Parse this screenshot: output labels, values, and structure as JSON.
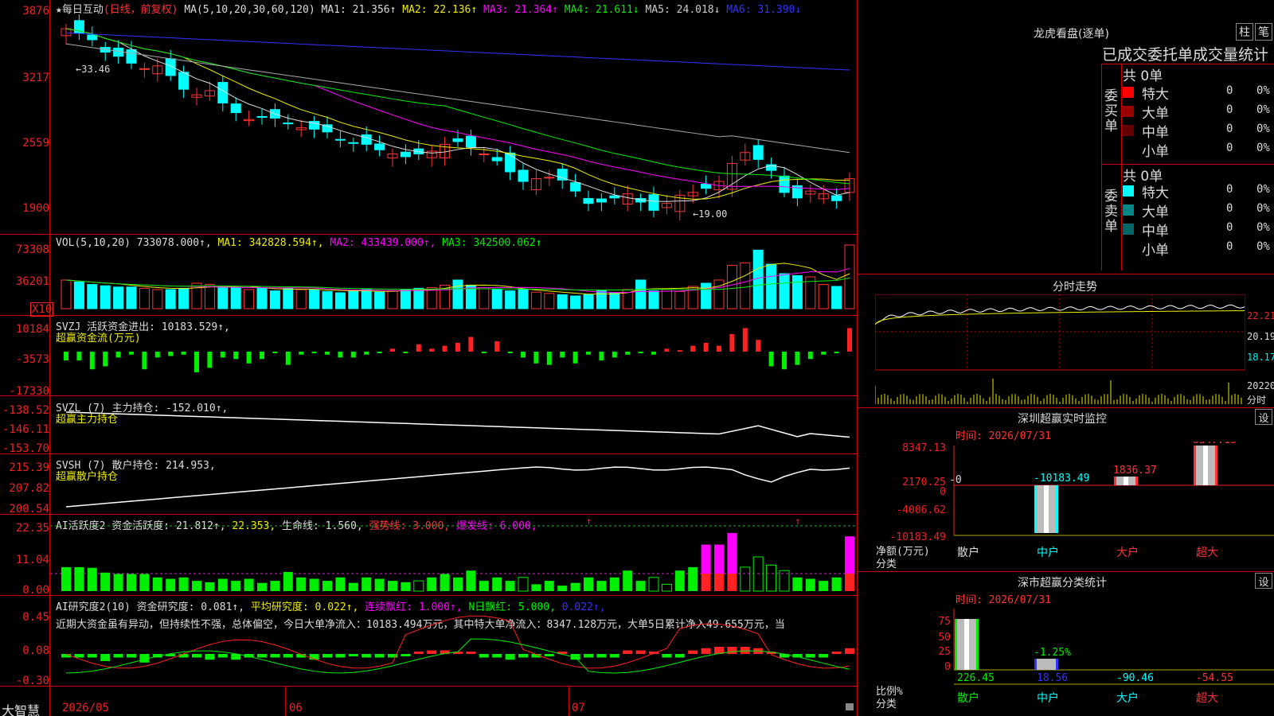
{
  "window": {
    "brand": "大智慧"
  },
  "main": {
    "star": "★",
    "stock_name": "每日互动",
    "period": "(日线，前复权)",
    "ma_label": "MA(5,10,20,30,60,120)",
    "ma": [
      {
        "label": "MA1: 21.356↑",
        "color": "#dddddd"
      },
      {
        "label": "MA2: 22.136↑",
        "color": "#eeee00"
      },
      {
        "label": "MA3: 21.364↑",
        "color": "#ff00ff"
      },
      {
        "label": "MA4: 21.611↓",
        "color": "#00ee00"
      },
      {
        "label": "MA5: 24.018↓",
        "color": "#aaaaaa"
      },
      {
        "label": "MA6: 31.390↓",
        "color": "#3333ff"
      }
    ],
    "yticks": [
      "3876",
      "3217",
      "2559",
      "1900"
    ],
    "high_label": "33.46",
    "low_label": "19.00"
  },
  "vol": {
    "title": "VOL(5,10,20)",
    "value": "733078.000↑,",
    "ma1": "MA1: 342828.594↑,",
    "ma2": "MA2: 433439.000↑,",
    "ma3": "MA3: 342500.062↑",
    "yticks": [
      "73308",
      "36201"
    ],
    "unit": "X10"
  },
  "svzj": {
    "title": "SVZJ  活跃资金进出: 10183.529↑,",
    "sub": "超赢资金流(万元)",
    "yticks": [
      "10184",
      "-3573",
      "-17330"
    ]
  },
  "svzl": {
    "title": "SVZL (7) 主力持仓: -152.010↑,",
    "sub": "超赢主力持仓",
    "yticks": [
      "-138.52",
      "-146.11",
      "-153.70"
    ]
  },
  "svsh": {
    "title": "SVSH (7) 散户持仓: 214.953,",
    "sub": "超赢散户持仓",
    "yticks": [
      "215.39",
      "207.82",
      "200.54"
    ]
  },
  "ai1": {
    "title": "AI活跃度2 资金活跃度: 21.812↑,",
    "v2": "22.353,",
    "v3": "生命线: 1.560,",
    "v4": "强势线: 3.000,",
    "v5": "爆发线: 6.000,",
    "yticks": [
      "22.35",
      "11.04",
      "0.00"
    ]
  },
  "ai2": {
    "title": "AI研究度2(10) 资金研究度: 0.081↑,",
    "v2": "平均研究度: 0.022↑,",
    "v3": "连续飘红: 1.000↑,",
    "v4": "N日飘红: 5.000,",
    "v5": "0.022↑,",
    "text": "近期大资金虽有异动，但持续性不强，总体偏空，今日大单净流入：10183.494万元，其中特大单净流入：8347.128万元，大单5日累计净入49.655万元，当",
    "yticks": [
      "0.45",
      "0.08",
      "-0.30"
    ]
  },
  "xaxis": [
    "2026/05",
    "06",
    "07"
  ],
  "right": {
    "lhkp_title": "龙虎看盘(逐单)",
    "btn1": "柱",
    "btn2": "笔",
    "tabs": "已成交委托单成交量统计",
    "buy_label": "委买单",
    "sell_label": "委卖单",
    "buy_total": "共 0单",
    "sell_total": "共 0单",
    "buy_rows": [
      {
        "name": "特大",
        "count": "0",
        "pct": "0%",
        "color": "#ff0000"
      },
      {
        "name": "大单",
        "count": "0",
        "pct": "0%",
        "color": "#990000"
      },
      {
        "name": "中单",
        "count": "0",
        "pct": "0%",
        "color": "#660000"
      },
      {
        "name": "小单",
        "count": "0",
        "pct": "0%",
        "color": "#000000"
      }
    ],
    "sell_rows": [
      {
        "name": "特大",
        "count": "0",
        "pct": "0%",
        "color": "#00ffff"
      },
      {
        "name": "大单",
        "count": "0",
        "pct": "0%",
        "color": "#008888"
      },
      {
        "name": "中单",
        "count": "0",
        "pct": "0%",
        "color": "#006666"
      },
      {
        "name": "小单",
        "count": "0",
        "pct": "0%",
        "color": "#000000"
      }
    ],
    "fs_title": "分时走势",
    "fs_yticks": [
      "22.21",
      "20.19",
      "18.17"
    ],
    "fs_bottom": [
      "20220",
      "分时"
    ],
    "sz_title": "深圳超赢实时监控",
    "sz_btn": "设",
    "sz_time": "时间: 2026/07/31",
    "sz_yticks": [
      "8347.13",
      "2170.25",
      "0",
      "-4006.62",
      "-10183.49"
    ],
    "sz_zero": "-0",
    "sz_unit1": "净额(万元)",
    "sz_unit2": "分类",
    "sz_cats": [
      "散户",
      "中户",
      "大户",
      "超大"
    ],
    "sz_vals": [
      "-10183.49",
      "1836.37",
      "8347.13"
    ],
    "ss_title": "深市超赢分类统计",
    "ss_btn": "设",
    "ss_time": "时间: 2026/07/31",
    "ss_yticks": [
      "75",
      "50",
      "25",
      "0"
    ],
    "ss_unit1": "比例%",
    "ss_unit2": "分类",
    "ss_pct": "-1.25%",
    "ss_vals": [
      "226.45",
      "18.56",
      "-90.46",
      "-54.55"
    ],
    "ss_cats": [
      "散户",
      "中户",
      "大户",
      "超大"
    ]
  },
  "chart_data": [
    {
      "type": "candlestick",
      "title": "每日互动(日线，前复权)",
      "ylim": [
        19.0,
        33.46
      ],
      "categories": [
        "2026/05",
        "06",
        "07"
      ],
      "close": [
        32.7,
        32.4,
        31.9,
        31.0,
        30.7,
        30.2,
        29.8,
        30.0,
        29.3,
        28.3,
        27.9,
        28.2,
        27.3,
        26.6,
        26.1,
        26.3,
        26.2,
        25.8,
        25.5,
        25.4,
        25.2,
        24.6,
        24.4,
        24.3,
        23.9,
        23.6,
        23.4,
        23.6,
        23.8,
        24.3,
        24.5,
        24.1,
        23.6,
        23.1,
        22.3,
        21.6,
        21.8,
        21.9,
        21.7,
        20.9,
        20.0,
        20.1,
        20.4,
        20.7,
        20.1,
        19.5,
        20.0,
        20.6,
        20.8,
        21.1,
        21.6,
        22.9,
        23.7,
        23.2,
        22.4,
        20.8,
        20.4,
        20.9,
        20.7,
        20.2,
        21.8
      ]
    },
    {
      "type": "bar",
      "title": "VOL(5,10,20)",
      "ylim": [
        0,
        73308
      ]
    },
    {
      "type": "bar",
      "title": "SVZJ 活跃资金进出",
      "ylim": [
        -17330,
        10184
      ]
    },
    {
      "type": "line",
      "title": "SVZL (7) 主力持仓",
      "ylim": [
        -153.7,
        -138.52
      ]
    },
    {
      "type": "line",
      "title": "SVSH (7) 散户持仓",
      "ylim": [
        200.54,
        215.39
      ]
    },
    {
      "type": "bar",
      "title": "AI活跃度2",
      "ylim": [
        0,
        22.35
      ]
    },
    {
      "type": "bar",
      "title": "AI研究度2(10)",
      "ylim": [
        -0.3,
        0.45
      ]
    },
    {
      "type": "bar",
      "title": "深圳超赢实时监控",
      "categories": [
        "散户",
        "中户",
        "大户",
        "超大"
      ],
      "values": [
        0,
        -10183.49,
        1836.37,
        8347.13
      ],
      "ylim": [
        -10183.49,
        8347.13
      ]
    },
    {
      "type": "bar",
      "title": "深市超赢分类统计",
      "categories": [
        "散户",
        "中户",
        "大户",
        "超大"
      ],
      "values": [
        226.45,
        18.56,
        -90.46,
        -54.55
      ]
    }
  ]
}
